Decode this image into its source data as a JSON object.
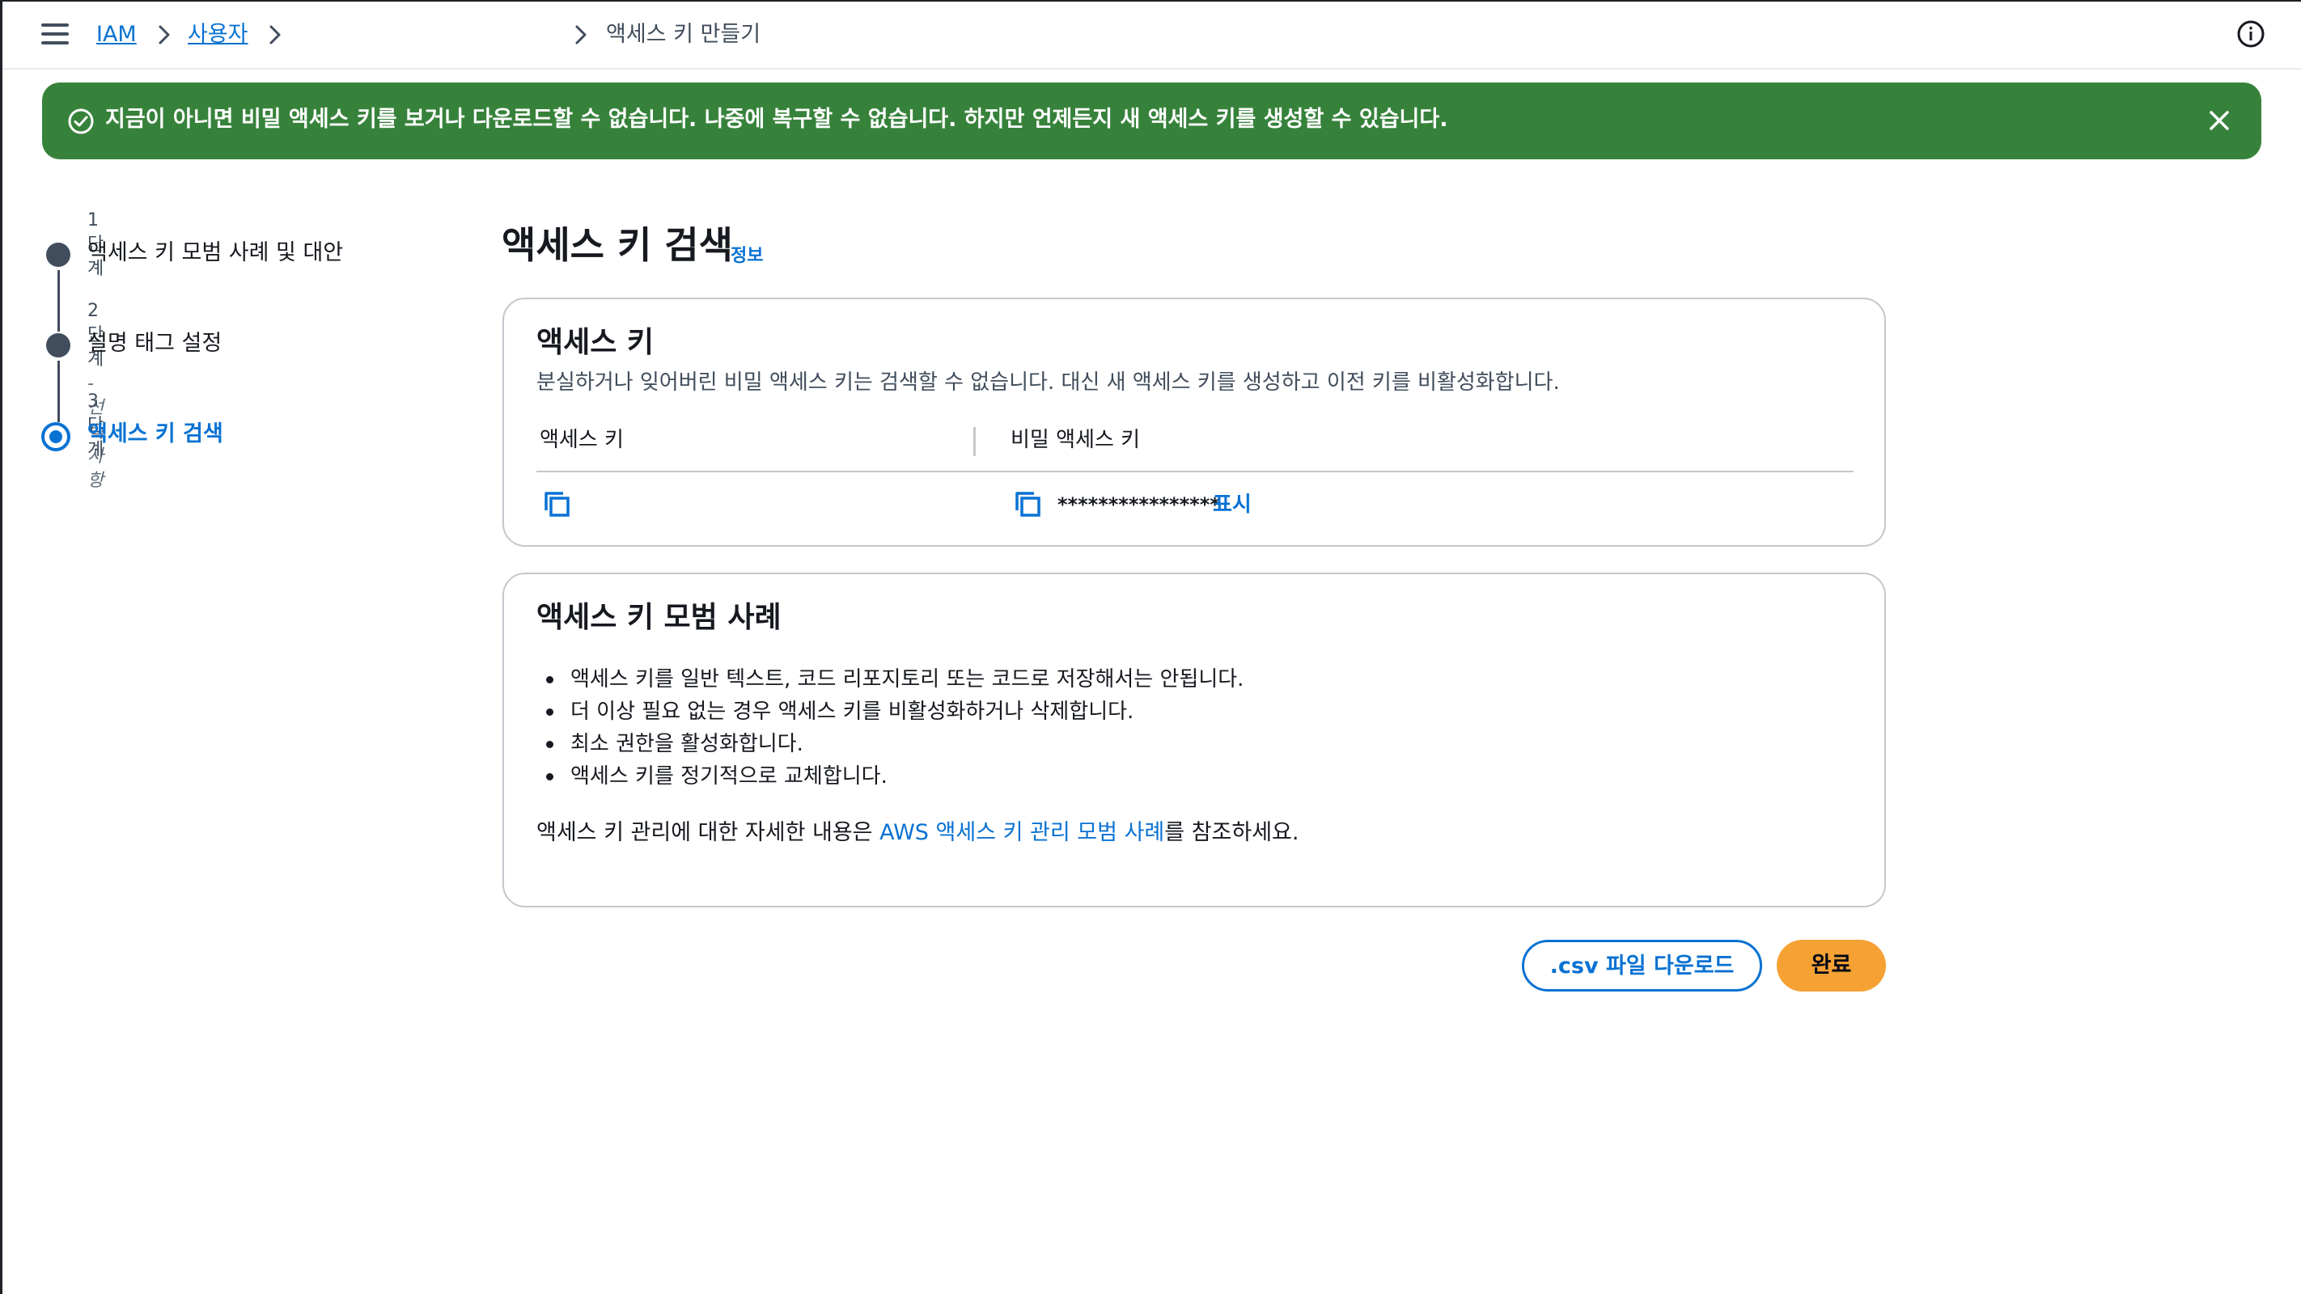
{
  "breadcrumb": {
    "items": [
      "IAM",
      "사용자"
    ],
    "current": "액세스 키 만들기"
  },
  "flash": {
    "message": "지금이 아니면 비밀 액세스 키를 보거나 다운로드할 수 없습니다. 나중에 복구할 수 없습니다. 하지만 언제든지 새 액세스 키를 생성할 수 있습니다.",
    "color": "#37823b"
  },
  "steps": [
    {
      "number": "1단계",
      "optional": "",
      "title": "액세스 키 모범 사례 및 대안"
    },
    {
      "number": "2단계",
      "optional": "- 선택 사항",
      "title": "설명 태그 설정"
    },
    {
      "number": "3단계",
      "optional": "",
      "title": "액세스 키 검색"
    }
  ],
  "page": {
    "title": "액세스 키 검색",
    "info_link": "정보"
  },
  "access_key_card": {
    "title": "액세스 키",
    "description": "분실하거나 잊어버린 비밀 액세스 키는 검색할 수 없습니다. 대신 새 액세스 키를 생성하고 이전 키를 비활성화합니다.",
    "columns": [
      "액세스 키",
      "비밀 액세스 키"
    ],
    "secret_masked": "****************",
    "show_label": "표시"
  },
  "best_practices_card": {
    "title": "액세스 키 모범 사례",
    "bullets": [
      "액세스 키를 일반 텍스트, 코드 리포지토리 또는 코드로 저장해서는 안됩니다.",
      "더 이상 필요 없는 경우 액세스 키를 비활성화하거나 삭제합니다.",
      "최소 권한을 활성화합니다.",
      "액세스 키를 정기적으로 교체합니다."
    ],
    "ref_prefix": "액세스 키 관리에 대한 자세한 내용은 ",
    "ref_link": "AWS 액세스 키 관리 모범 사례",
    "ref_suffix": "를 참조하세요."
  },
  "actions": {
    "download_label": ".csv 파일 다운로드",
    "done_label": "완료"
  },
  "colors": {
    "link": "#0972d3",
    "primary_button": "#f5a134"
  }
}
